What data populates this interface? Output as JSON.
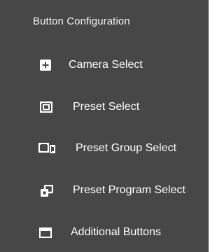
{
  "panel": {
    "title": "Button Configuration",
    "background": "#474747",
    "items": [
      {
        "label": "Camera Select",
        "icon": "add-box-icon"
      },
      {
        "label": "Preset Select",
        "icon": "preset-frame-icon"
      },
      {
        "label": "Preset Group Select",
        "icon": "preset-group-icon"
      },
      {
        "label": "Preset Program Select",
        "icon": "preset-program-icon"
      },
      {
        "label": "Additional Buttons",
        "icon": "window-icon"
      }
    ]
  }
}
